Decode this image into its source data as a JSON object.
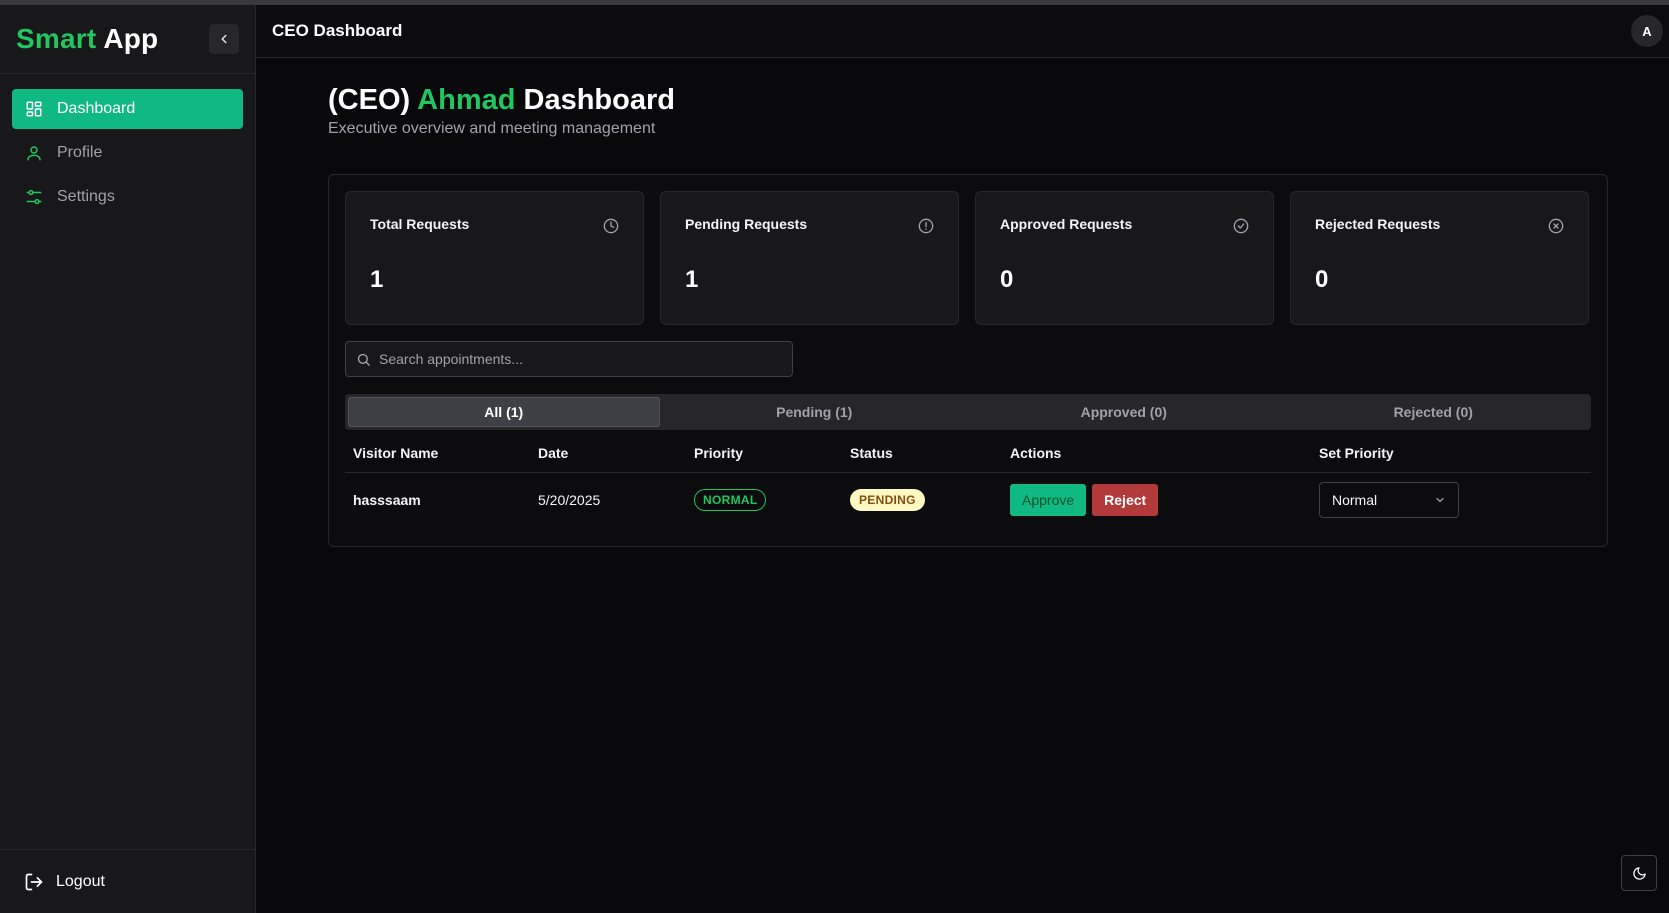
{
  "brand": {
    "part1": "Smart",
    "part2": "App"
  },
  "sidebar": {
    "items": [
      {
        "label": "Dashboard",
        "icon": "dashboard-grid-icon",
        "active": true
      },
      {
        "label": "Profile",
        "icon": "user-icon",
        "active": false
      },
      {
        "label": "Settings",
        "icon": "sliders-icon",
        "active": false
      }
    ],
    "logout_label": "Logout"
  },
  "header": {
    "title": "CEO Dashboard",
    "avatar_initial": "A"
  },
  "page": {
    "title_prefix": "(CEO)",
    "title_name": "Ahmad",
    "title_suffix": "Dashboard",
    "subtitle": "Executive overview and meeting management"
  },
  "stats": [
    {
      "label": "Total Requests",
      "value": "1",
      "icon": "clock-icon"
    },
    {
      "label": "Pending Requests",
      "value": "1",
      "icon": "alert-circle-icon"
    },
    {
      "label": "Approved Requests",
      "value": "0",
      "icon": "check-circle-icon"
    },
    {
      "label": "Rejected Requests",
      "value": "0",
      "icon": "x-circle-icon"
    }
  ],
  "search": {
    "placeholder": "Search appointments...",
    "value": ""
  },
  "tabs": [
    {
      "label": "All (1)",
      "active": true
    },
    {
      "label": "Pending (1)",
      "active": false
    },
    {
      "label": "Approved (0)",
      "active": false
    },
    {
      "label": "Rejected (0)",
      "active": false
    }
  ],
  "table": {
    "columns": [
      "Visitor Name",
      "Date",
      "Priority",
      "Status",
      "Actions",
      "Set Priority"
    ],
    "rows": [
      {
        "visitor": "hasssaam",
        "date": "5/20/2025",
        "priority": "NORMAL",
        "status": "PENDING",
        "approve_label": "Approve",
        "reject_label": "Reject",
        "set_priority": "Normal"
      }
    ]
  },
  "colors": {
    "accent": "#22c55e",
    "active_nav": "#10b981",
    "reject": "#b33a3a",
    "pending_bg": "#fef9c3"
  }
}
